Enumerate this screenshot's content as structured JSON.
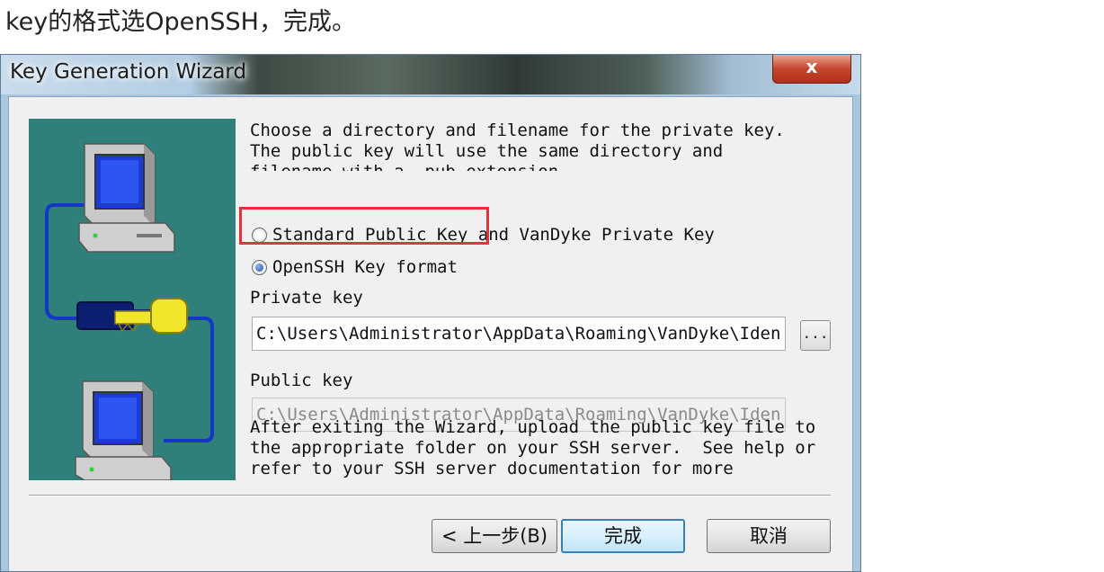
{
  "caption": "key的格式选OpenSSH，完成。",
  "window": {
    "title": "Key Generation Wizard",
    "close_label": "x"
  },
  "wizard": {
    "intro_text": "Choose a directory and filename for the private key.\nThe public key will use the same directory and\nfilename with a .pub extension.",
    "format_options": [
      {
        "label": "Standard Public Key and VanDyke Private Key",
        "selected": false
      },
      {
        "label": "OpenSSH Key format",
        "selected": true
      }
    ],
    "private_key": {
      "label": "Private key",
      "value": "C:\\Users\\Administrator\\AppData\\Roaming\\VanDyke\\Iden"
    },
    "browse_label": "...",
    "public_key": {
      "label": "Public key",
      "value": "C:\\Users\\Administrator\\AppData\\Roaming\\VanDyke\\Iden"
    },
    "after_text": "After exiting the Wizard, upload the public key file to\nthe appropriate folder on your SSH server.  See help or\nrefer to your SSH server documentation for more\ninformation."
  },
  "buttons": {
    "back": "< 上一步(B)",
    "finish": "完成",
    "cancel": "取消"
  },
  "colors": {
    "highlight": "#e0353b",
    "art_background": "#2f7f7a",
    "cable": "#1437c8",
    "key_yellow": "#f2e62c",
    "key_navy": "#0d1f73"
  }
}
